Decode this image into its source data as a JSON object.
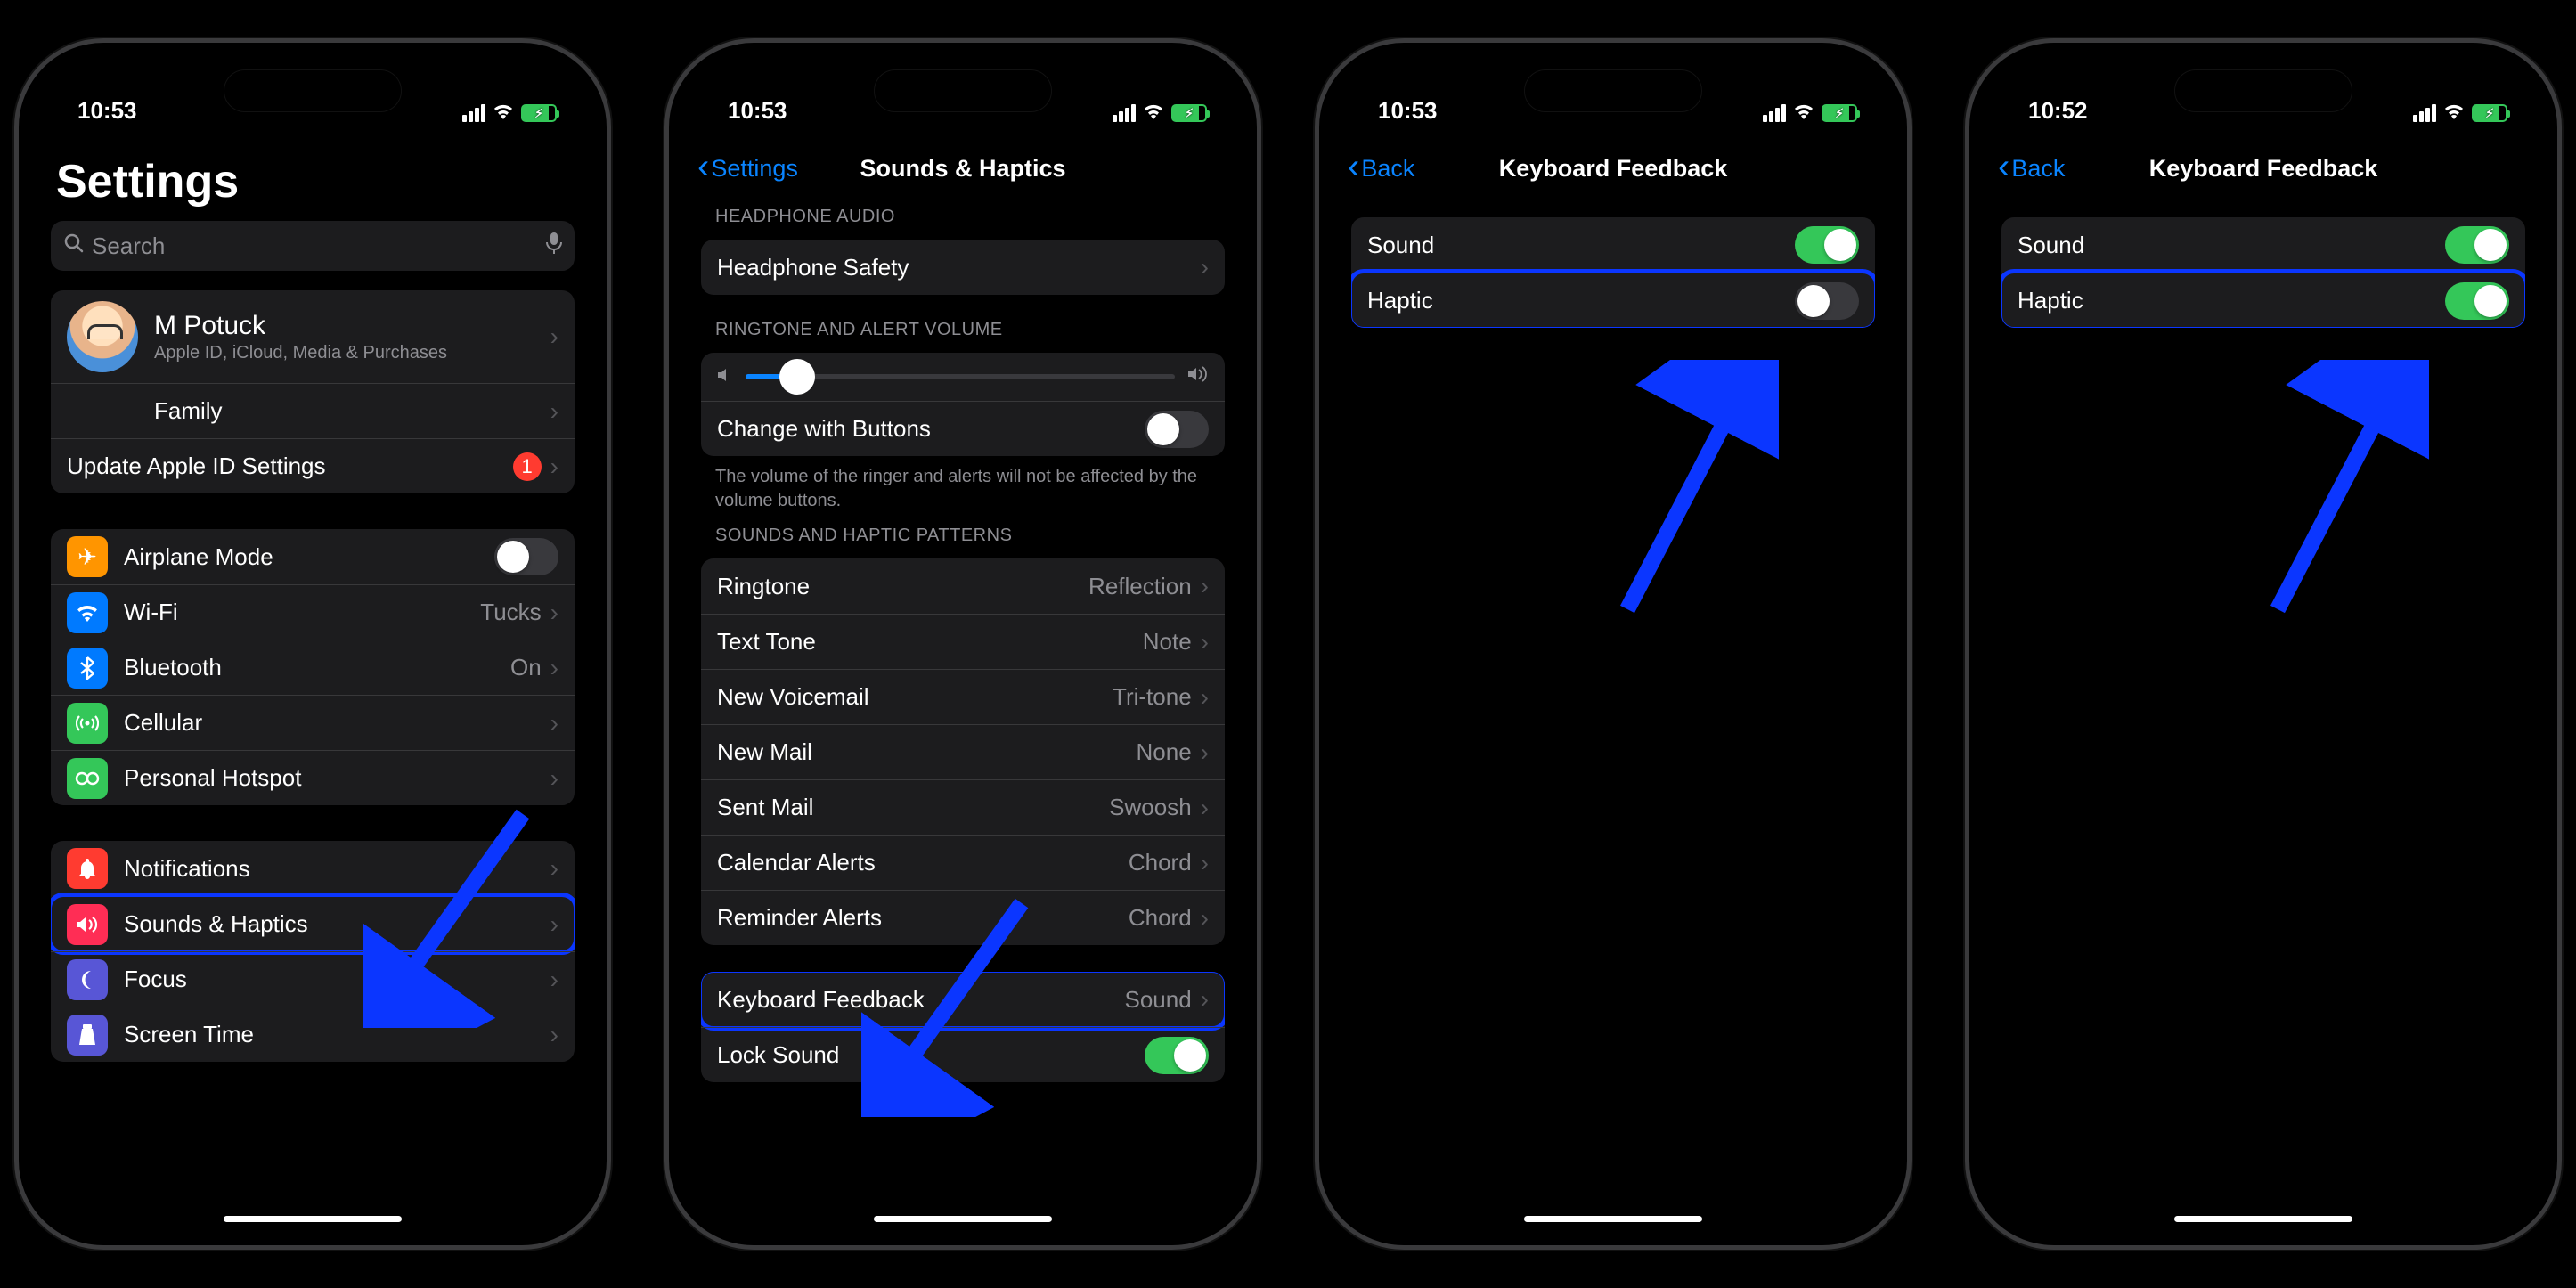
{
  "status": {
    "time1": "10:53",
    "time2": "10:53",
    "time3": "10:53",
    "time4": "10:52"
  },
  "s1": {
    "title": "Settings",
    "searchPlaceholder": "Search",
    "profile": {
      "name": "M Potuck",
      "sub": "Apple ID, iCloud, Media & Purchases"
    },
    "family": "Family",
    "updateApple": "Update Apple ID Settings",
    "badge": "1",
    "airplane": "Airplane Mode",
    "wifi": {
      "label": "Wi-Fi",
      "value": "Tucks"
    },
    "bluetooth": {
      "label": "Bluetooth",
      "value": "On"
    },
    "cellular": "Cellular",
    "hotspot": "Personal Hotspot",
    "notifications": "Notifications",
    "sounds": "Sounds & Haptics",
    "focus": "Focus",
    "screentime": "Screen Time"
  },
  "s2": {
    "back": "Settings",
    "title": "Sounds & Haptics",
    "hHeadphone": "HEADPHONE AUDIO",
    "headphoneSafety": "Headphone Safety",
    "hRingtone": "RINGTONE AND ALERT VOLUME",
    "changeButtons": "Change with Buttons",
    "footnote": "The volume of the ringer and alerts will not be affected by the volume buttons.",
    "hPatterns": "SOUNDS AND HAPTIC PATTERNS",
    "ringtone": {
      "label": "Ringtone",
      "value": "Reflection"
    },
    "text": {
      "label": "Text Tone",
      "value": "Note"
    },
    "voicemail": {
      "label": "New Voicemail",
      "value": "Tri-tone"
    },
    "mail": {
      "label": "New Mail",
      "value": "None"
    },
    "sent": {
      "label": "Sent Mail",
      "value": "Swoosh"
    },
    "cal": {
      "label": "Calendar Alerts",
      "value": "Chord"
    },
    "rem": {
      "label": "Reminder Alerts",
      "value": "Chord"
    },
    "kb": {
      "label": "Keyboard Feedback",
      "value": "Sound"
    },
    "lock": "Lock Sound"
  },
  "s3": {
    "back": "Back",
    "title": "Keyboard Feedback",
    "sound": "Sound",
    "haptic": "Haptic"
  },
  "s4": {
    "back": "Back",
    "title": "Keyboard Feedback",
    "sound": "Sound",
    "haptic": "Haptic"
  }
}
